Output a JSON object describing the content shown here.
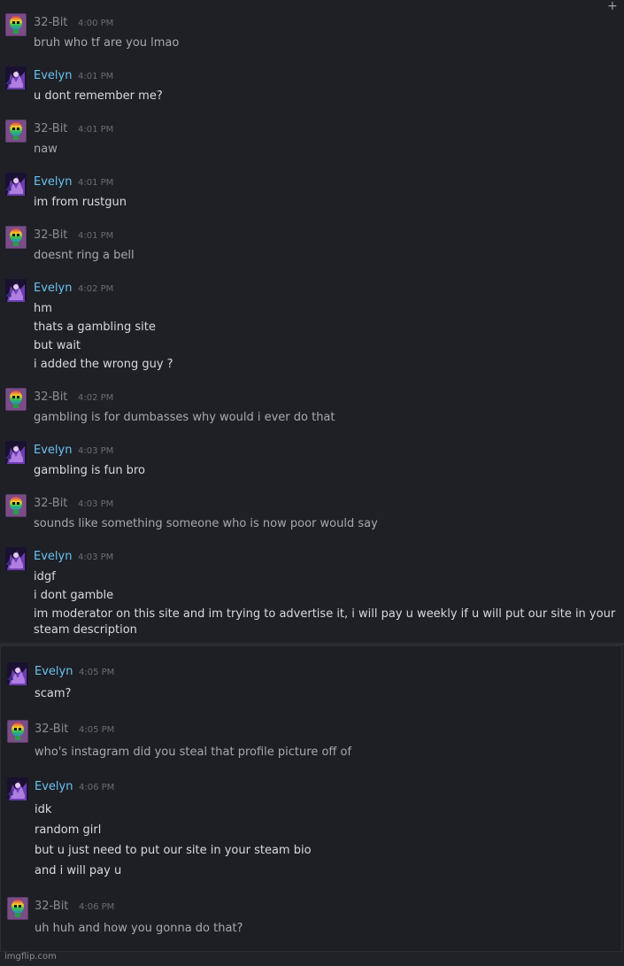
{
  "ui": {
    "add_button": "+",
    "watermark": "imgflip.com"
  },
  "users": {
    "bit": {
      "name": "32-Bit"
    },
    "eve": {
      "name": "Evelyn"
    }
  },
  "messages": [
    {
      "user": "bit",
      "time": "4:00 PM",
      "lines": [
        "bruh who tf are you lmao"
      ]
    },
    {
      "user": "eve",
      "time": "4:01 PM",
      "lines": [
        "u dont remember me?"
      ]
    },
    {
      "user": "bit",
      "time": "4:01 PM",
      "lines": [
        "naw"
      ]
    },
    {
      "user": "eve",
      "time": "4:01 PM",
      "lines": [
        "im from rustgun"
      ]
    },
    {
      "user": "bit",
      "time": "4:01 PM",
      "lines": [
        "doesnt ring a bell"
      ]
    },
    {
      "user": "eve",
      "time": "4:02 PM",
      "lines": [
        "hm",
        "thats a gambling site",
        "but wait",
        "i added the wrong guy ?"
      ]
    },
    {
      "user": "bit",
      "time": "4:02 PM",
      "lines": [
        "gambling is for dumbasses why would i ever do that"
      ]
    },
    {
      "user": "eve",
      "time": "4:03 PM",
      "lines": [
        "gambling is fun bro"
      ]
    },
    {
      "user": "bit",
      "time": "4:03 PM",
      "lines": [
        "sounds like something someone who is now poor would say"
      ]
    },
    {
      "user": "eve",
      "time": "4:03 PM",
      "lines": [
        "idgf",
        "i dont gamble",
        "im moderator on this site and im trying to advertise it, i will pay u weekly if u will put our site in your",
        "steam description"
      ]
    },
    {
      "user": "eve",
      "time": "4:05 PM",
      "lines": [
        "scam?"
      ]
    },
    {
      "user": "bit",
      "time": "4:05 PM",
      "lines": [
        "who's instagram did you steal that profile picture off of"
      ]
    },
    {
      "user": "eve",
      "time": "4:06 PM",
      "lines": [
        "idk",
        "random girl",
        "but u just need to put our site in your steam bio",
        "and i will pay u"
      ]
    },
    {
      "user": "bit",
      "time": "4:06 PM",
      "lines": [
        "uh huh and how you gonna do that?"
      ]
    }
  ]
}
